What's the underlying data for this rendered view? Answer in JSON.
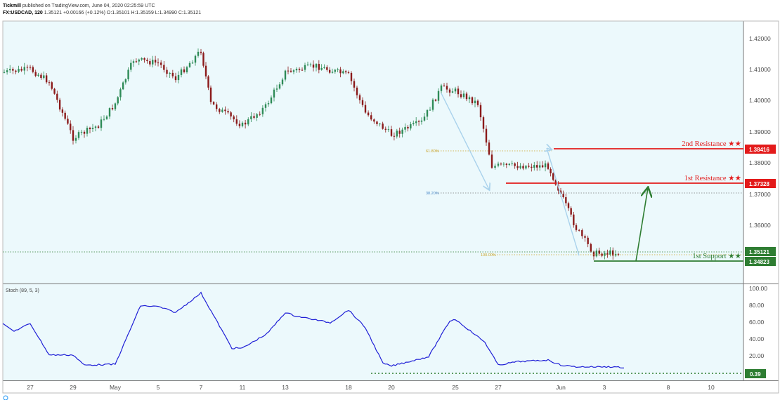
{
  "header": {
    "publisher": "Tickmill",
    "published_text": "published on TradingView.com, June 04, 2020 02:25:59 UTC",
    "symbol": "FX:USDCAD, 120",
    "price": "1.35121",
    "change": "+0.00166 (+0.12%)",
    "ohlc": "O:1.35101 H:1.35159 L:1.34990 C:1.35121"
  },
  "colors": {
    "background": "#ecf9fc",
    "bull": "#2e8b57",
    "bear": "#8b1a1a",
    "resistance": "#e31b1b",
    "support": "#2e7d32",
    "stoch": "#1f1fd6",
    "arrow_blue": "#a9d2ec",
    "arrow_green": "#2e7d32"
  },
  "price_axis": {
    "ticks": [
      "1.42000",
      "1.41000",
      "1.40000",
      "1.39000",
      "1.38000",
      "1.37000",
      "1.36000"
    ],
    "labels": {
      "second_resistance": "1.38416",
      "first_resistance": "1.37328",
      "current": "1.35121",
      "first_support": "1.34823"
    }
  },
  "annotations": {
    "second_resistance": "2nd Resistance ★★",
    "first_resistance": "1st Resistance ★★",
    "first_support": "1st Support ★★",
    "fib_618": "61.80%",
    "fib_382": "38.20%",
    "fib_100": "100.00%"
  },
  "stochastic": {
    "title": "Stoch (89, 5, 3)",
    "ticks": [
      "100.00",
      "80.00",
      "60.00",
      "40.00",
      "20.00"
    ],
    "current_label": "0.39"
  },
  "time_axis": {
    "labels": [
      "27",
      "29",
      "May",
      "5",
      "7",
      "11",
      "13",
      "18",
      "20",
      "25",
      "27",
      "Jun",
      "3",
      "8",
      "10"
    ]
  },
  "chart_data": [
    {
      "type": "line",
      "title": "",
      "note": "USDCAD 2-hour candles, approximate close path",
      "x": [
        "27",
        "29",
        "May",
        "5",
        "7",
        "11",
        "13",
        "18",
        "20",
        "25",
        "27",
        "Jun",
        "3"
      ],
      "series": [
        {
          "values": [
            1.41,
            1.388,
            1.399,
            1.412,
            1.416,
            1.392,
            1.409,
            1.408,
            1.389,
            1.403,
            1.379,
            1.37,
            1.3512
          ]
        }
      ],
      "ylim": [
        1.343,
        1.426
      ],
      "levels": {
        "second_resistance": 1.38416,
        "first_resistance": 1.37328,
        "first_support": 1.34823,
        "current": 1.35121
      }
    },
    {
      "type": "line",
      "title": "",
      "x": [
        "27",
        "29",
        "May",
        "5",
        "7",
        "11",
        "13",
        "18",
        "20",
        "25",
        "27",
        "Jun",
        "3"
      ],
      "series": [
        {
          "values": [
            57,
            20,
            9,
            77,
            93,
            28,
            70,
            73,
            7,
            62,
            8,
            8,
            6
          ]
        }
      ],
      "ylim": [
        0,
        100
      ]
    }
  ]
}
